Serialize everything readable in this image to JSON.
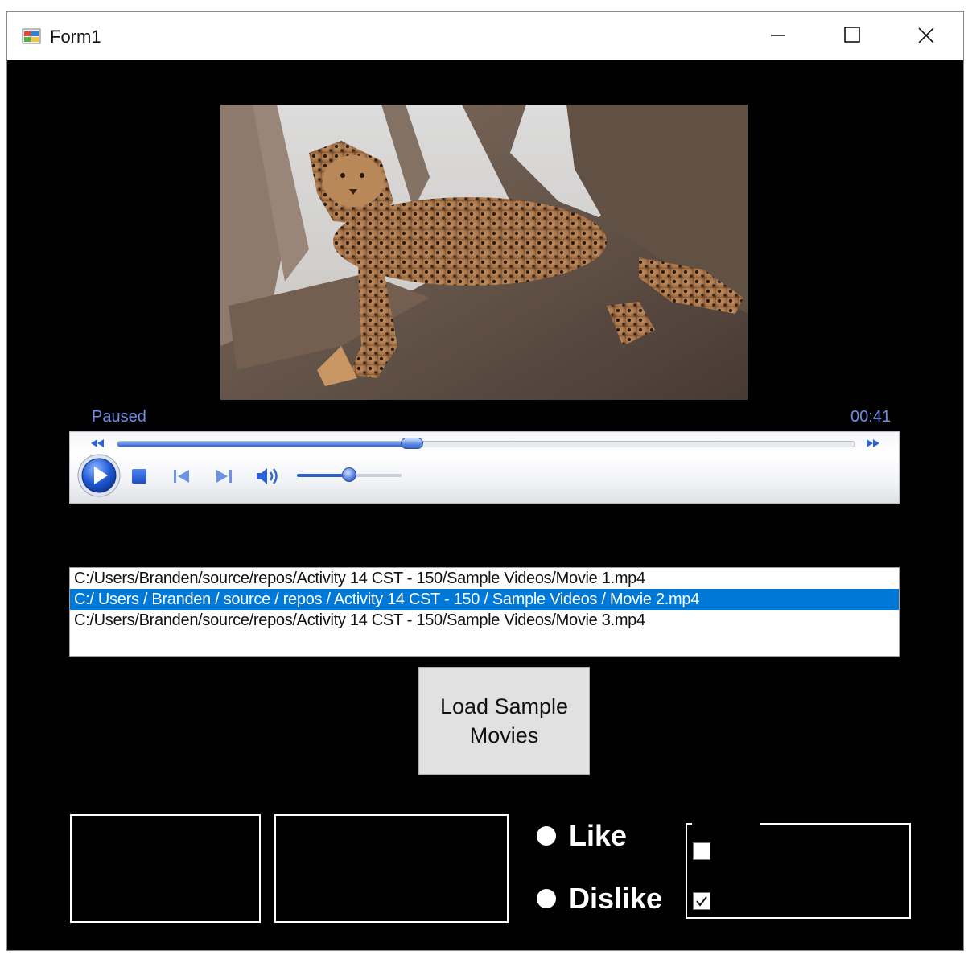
{
  "window": {
    "title": "Form1"
  },
  "player": {
    "status": "Paused",
    "time": "00:41",
    "seek_progress": 0.4,
    "volume_level": 0.5
  },
  "playlist": {
    "items": [
      "C:/Users/Branden/source/repos/Activity 14 CST - 150/Sample Videos/Movie 1.mp4",
      "C:/ Users / Branden / source / repos / Activity 14 CST - 150 / Sample Videos / Movie 2.mp4",
      "C:/Users/Branden/source/repos/Activity 14 CST - 150/Sample Videos/Movie 3.mp4"
    ],
    "selected_index": 1
  },
  "buttons": {
    "load_samples": "Load Sample Movies"
  },
  "rating": {
    "like": "Like",
    "dislike": "Dislike",
    "like_selected": false,
    "dislike_selected": false
  },
  "checkboxes": [
    {
      "checked": false
    },
    {
      "checked": true
    }
  ],
  "colors": {
    "selection": "#0078d7",
    "accent": "#6f8de6",
    "background": "#000000"
  }
}
